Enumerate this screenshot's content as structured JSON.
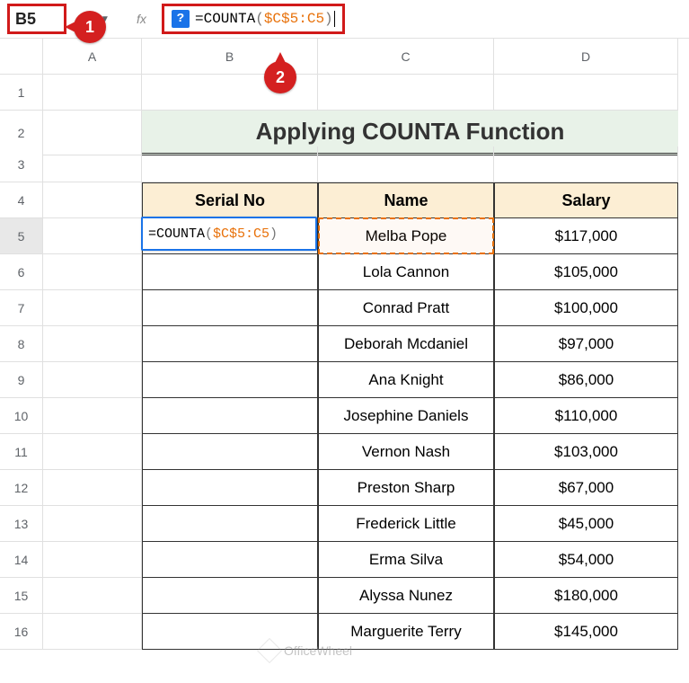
{
  "topbar": {
    "namebox": "B5",
    "fx": "fx",
    "help_chip": "?",
    "formula_eq": "=COUNTA",
    "formula_open": "(",
    "formula_range": "$C$5:C5",
    "formula_close": ")"
  },
  "annotations": {
    "badge1": "1",
    "badge2": "2"
  },
  "colHeaders": [
    "A",
    "B",
    "C",
    "D"
  ],
  "rowHeaders": [
    "1",
    "2",
    "3",
    "4",
    "5",
    "6",
    "7",
    "8",
    "9",
    "10",
    "11",
    "12",
    "13",
    "14",
    "15",
    "16"
  ],
  "title": "Applying COUNTA Function",
  "headers": {
    "serial": "Serial No",
    "name": "Name",
    "salary": "Salary"
  },
  "editingFormula": {
    "eq": "=COUNTA",
    "open": "(",
    "range": "$C$5:C5",
    "close": ")"
  },
  "rows": [
    {
      "name": "Melba Pope",
      "salary": "$117,000"
    },
    {
      "name": "Lola Cannon",
      "salary": "$105,000"
    },
    {
      "name": "Conrad Pratt",
      "salary": "$100,000"
    },
    {
      "name": "Deborah Mcdaniel",
      "salary": "$97,000"
    },
    {
      "name": "Ana Knight",
      "salary": "$86,000"
    },
    {
      "name": "Josephine Daniels",
      "salary": "$110,000"
    },
    {
      "name": "Vernon Nash",
      "salary": "$103,000"
    },
    {
      "name": "Preston Sharp",
      "salary": "$67,000"
    },
    {
      "name": "Frederick Little",
      "salary": "$45,000"
    },
    {
      "name": "Erma Silva",
      "salary": "$54,000"
    },
    {
      "name": "Alyssa Nunez",
      "salary": "$180,000"
    },
    {
      "name": "Marguerite Terry",
      "salary": "$145,000"
    }
  ],
  "watermark": "OfficeWheel"
}
